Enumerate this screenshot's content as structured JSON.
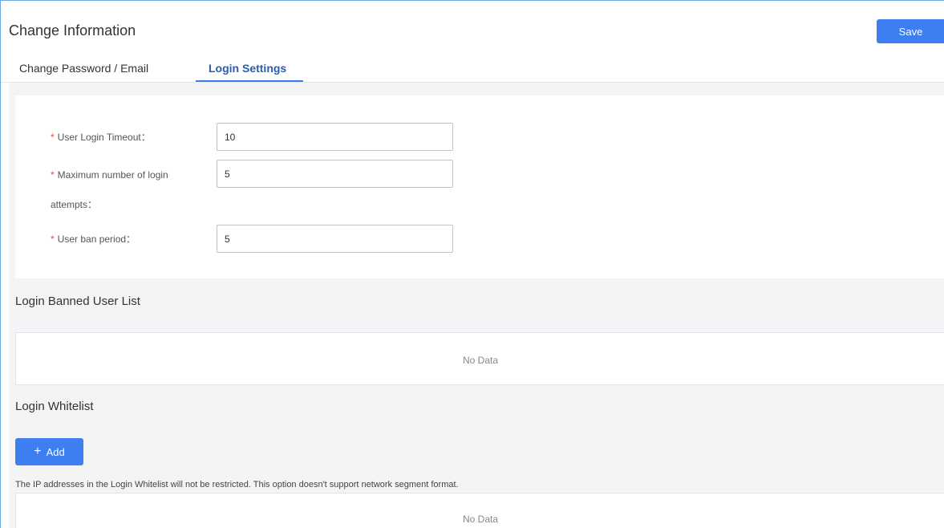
{
  "header": {
    "title": "Change Information",
    "save_label": "Save"
  },
  "tabs": [
    {
      "label": "Change Password / Email",
      "active": false
    },
    {
      "label": "Login Settings",
      "active": true
    }
  ],
  "form": {
    "timeout": {
      "label": "User Login Timeout：",
      "value": "10",
      "required": "*"
    },
    "attempts": {
      "label": "Maximum number of login attempts：",
      "value": "5",
      "required": "*"
    },
    "ban": {
      "label": "User ban period：",
      "value": "5",
      "required": "*"
    }
  },
  "banned_list": {
    "title": "Login Banned User List",
    "empty_text": "No Data"
  },
  "whitelist": {
    "title": "Login Whitelist",
    "add_icon": "+",
    "add_label": "Add",
    "note": "The IP addresses in the Login Whitelist will not be restricted. This option doesn't support network segment format.",
    "empty_text": "No Data"
  },
  "colors": {
    "accent": "#3d7ef0",
    "required": "#e8473f"
  }
}
